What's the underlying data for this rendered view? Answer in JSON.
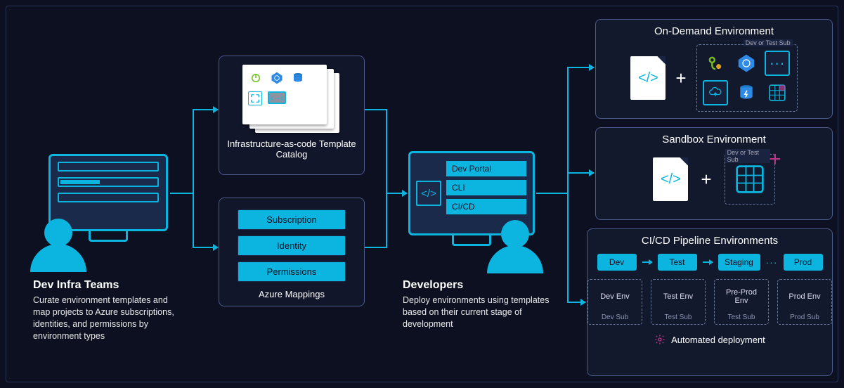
{
  "left": {
    "title": "Dev Infra Teams",
    "desc": "Curate environment templates and map projects to Azure subscriptions, identities, and permissions by environment types"
  },
  "catalog": {
    "label": "Infrastructure-as-code Template Catalog"
  },
  "mappings": {
    "label": "Azure Mappings",
    "items": [
      "Subscription",
      "Identity",
      "Permissions"
    ]
  },
  "developers": {
    "title": "Developers",
    "desc": "Deploy environments using templates based on their current stage of development",
    "portal_items": [
      "Dev Portal",
      "CLI",
      "CI/CD"
    ]
  },
  "ondemand": {
    "title": "On-Demand Environment",
    "sub_label": "Dev or Test Sub"
  },
  "sandbox": {
    "title": "Sandbox Environment",
    "sub_label": "Dev or Test Sub"
  },
  "pipeline": {
    "title": "CI/CD Pipeline Environments",
    "stages": [
      "Dev",
      "Test",
      "Staging",
      "Prod"
    ],
    "envs": [
      "Dev Env",
      "Test Env",
      "Pre-Prod Env",
      "Prod Env"
    ],
    "subs": [
      "Dev Sub",
      "Test Sub",
      "Test Sub",
      "Prod Sub"
    ],
    "footer": "Automated deployment",
    "ellipsis": "···"
  },
  "glyphs": {
    "plus": "+",
    "code": "</>"
  }
}
